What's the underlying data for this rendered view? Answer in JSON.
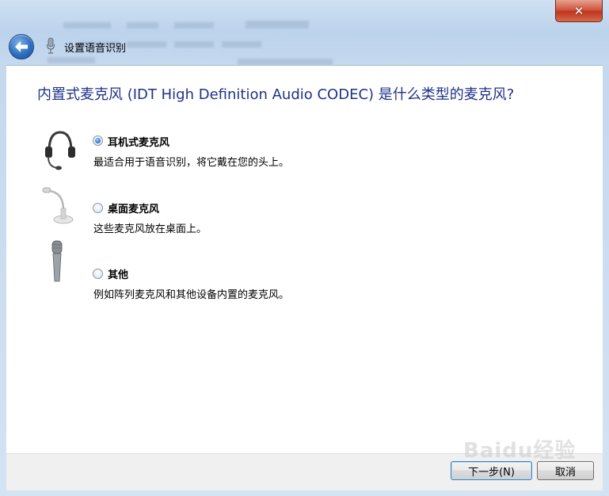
{
  "window": {
    "title": "设置语音识别",
    "close_glyph": "✕"
  },
  "question": "内置式麦克风 (IDT High Definition Audio CODEC) 是什么类型的麦克风?",
  "options": [
    {
      "label": "耳机式麦克风",
      "description": "最适合用于语音识别，将它戴在您的头上。",
      "selected": true,
      "icon": "headset-icon"
    },
    {
      "label": "桌面麦克风",
      "description": "这些麦克风放在桌面上。",
      "selected": false,
      "icon": "desktop-mic-icon"
    },
    {
      "label": "其他",
      "description": "例如阵列麦克风和其他设备内置的麦克风。",
      "selected": false,
      "icon": "handheld-mic-icon"
    }
  ],
  "buttons": {
    "next": "下一步(N)",
    "cancel": "取消"
  },
  "watermark": "Baidu经验",
  "colors": {
    "question_text": "#1e3287",
    "close_button": "#c0341d",
    "back_button": "#2e6fc0"
  }
}
